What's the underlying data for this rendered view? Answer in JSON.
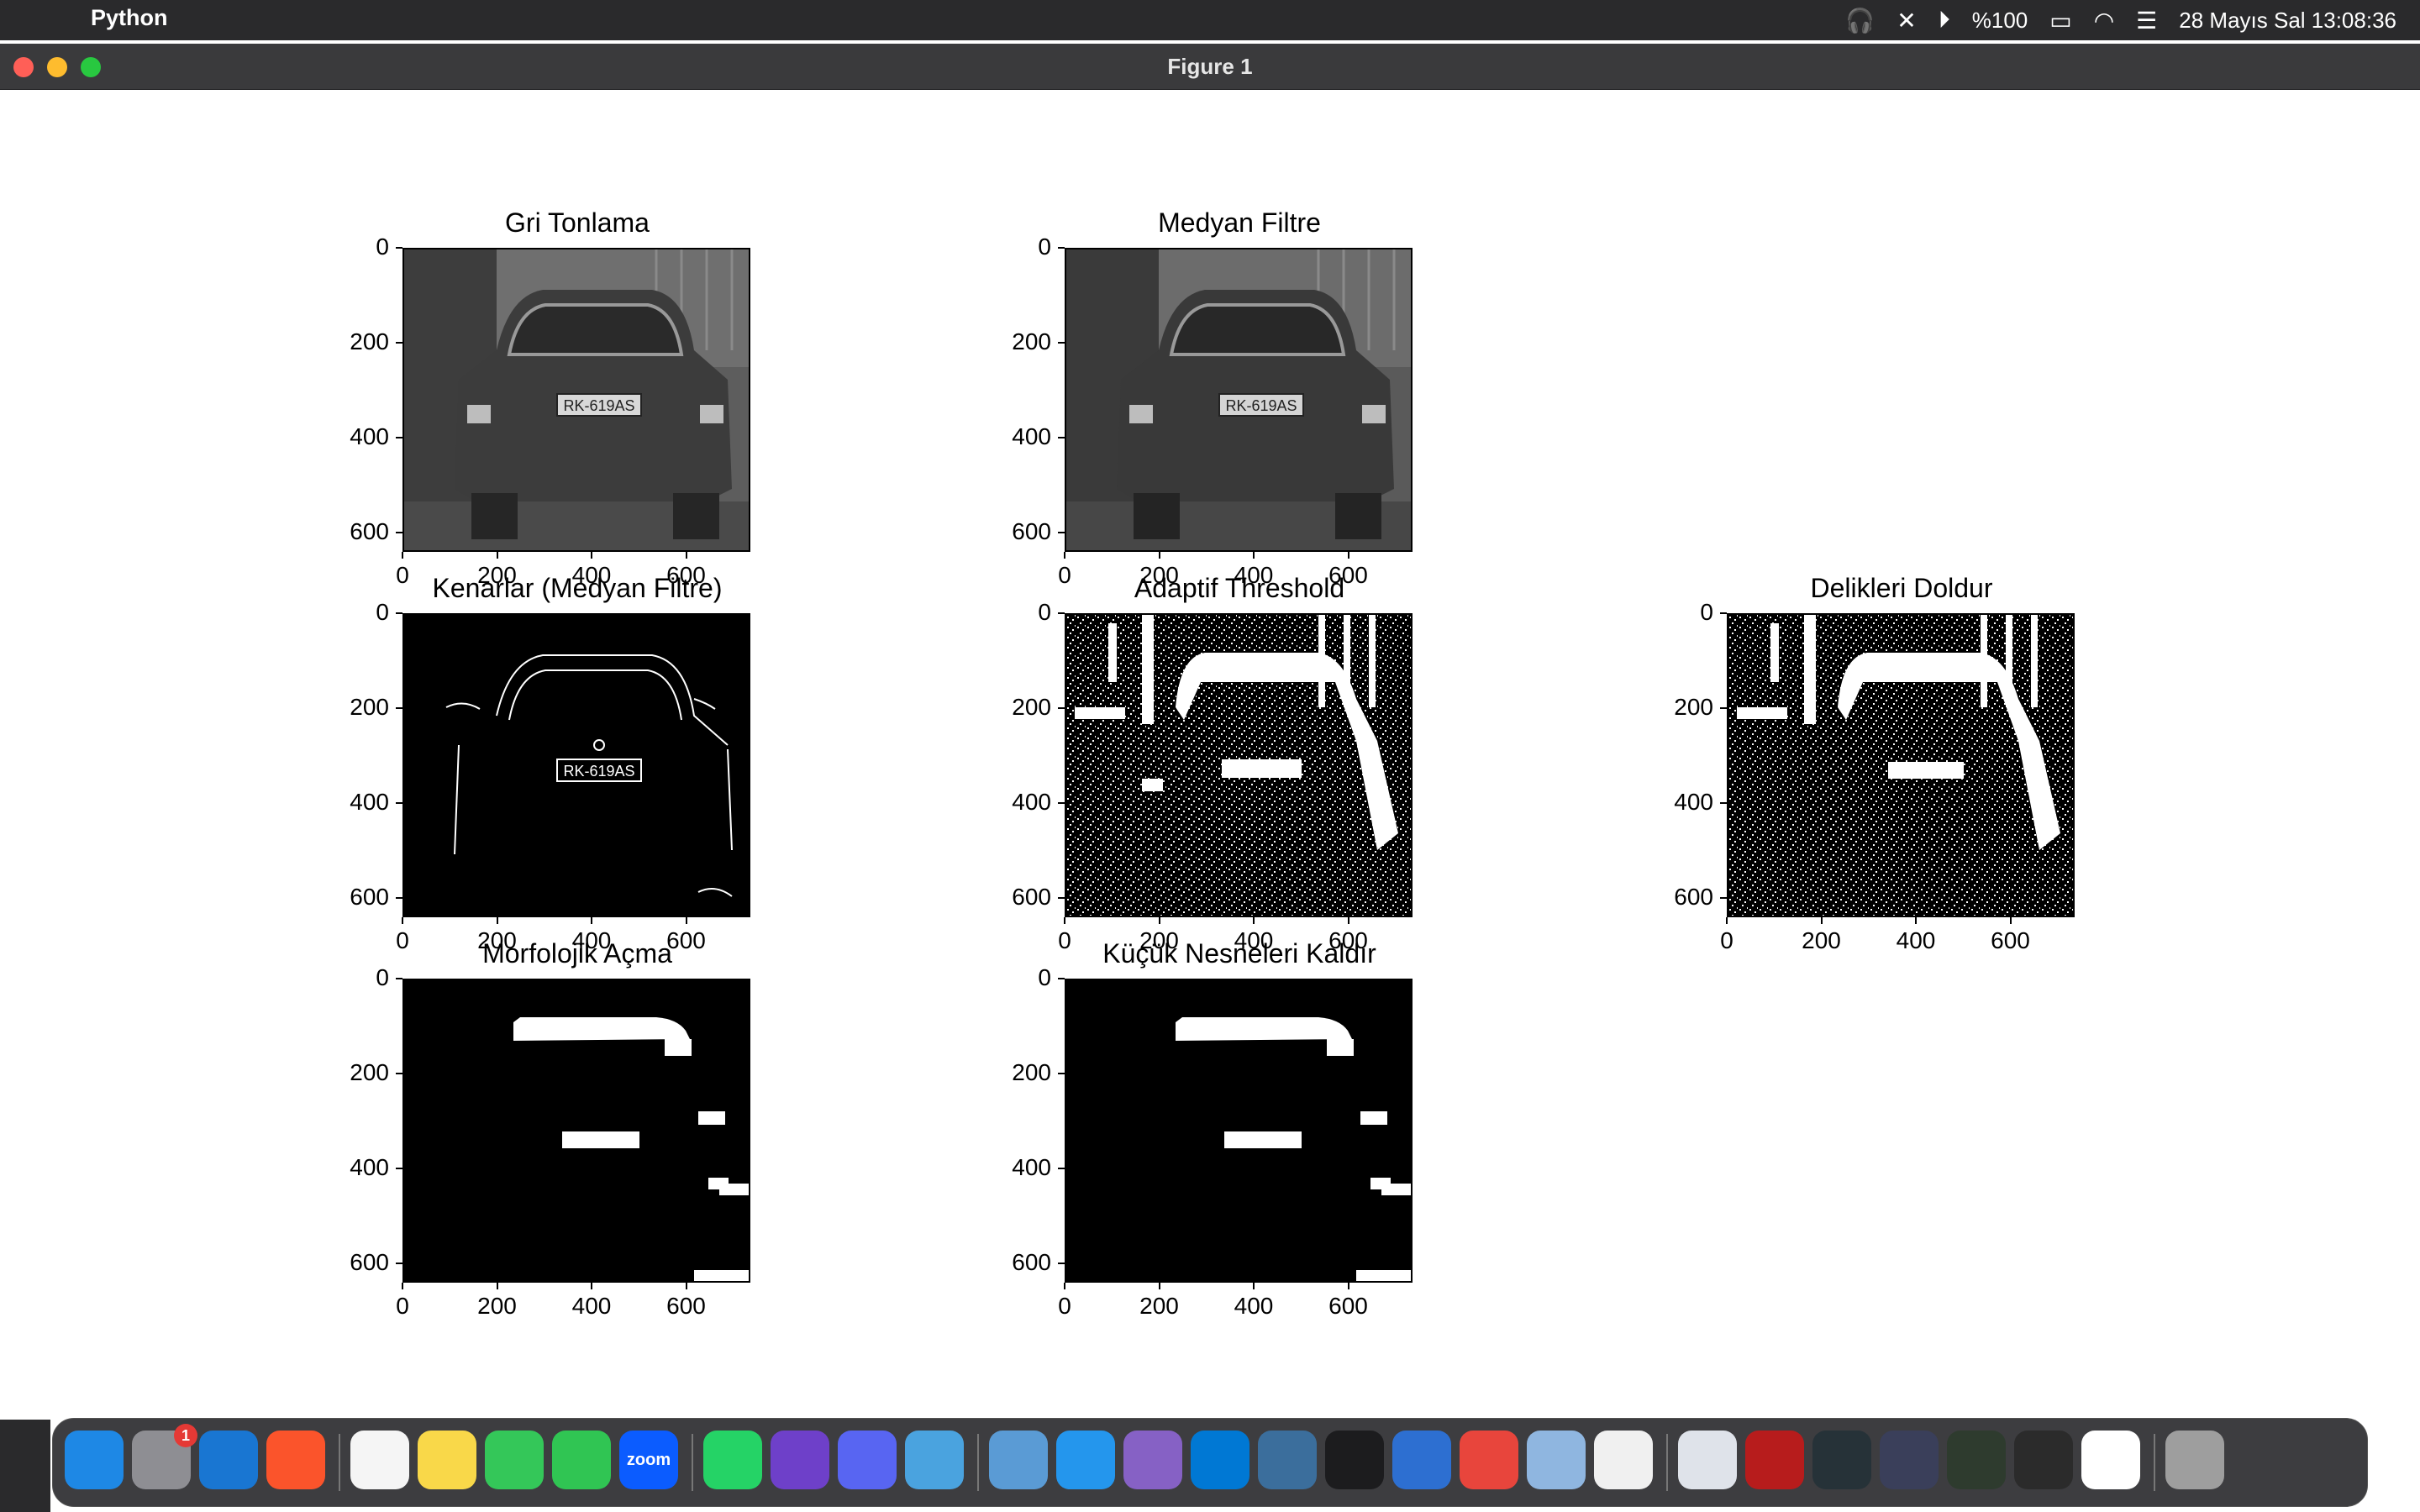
{
  "menubar": {
    "app_name": "Python",
    "battery": "%100",
    "datetime": "28 Mayıs Sal  13:08:36"
  },
  "window": {
    "title": "Figure 1"
  },
  "figure": {
    "subplots": [
      {
        "title": "Gri Tonlama",
        "yticks": [
          "0",
          "200",
          "400",
          "600"
        ],
        "xticks": [
          "0",
          "200",
          "400",
          "600"
        ]
      },
      {
        "title": "Medyan Filtre",
        "yticks": [
          "0",
          "200",
          "400",
          "600"
        ],
        "xticks": [
          "0",
          "200",
          "400",
          "600"
        ]
      },
      {
        "title": "Kenarlar (Medyan Filtre)",
        "yticks": [
          "0",
          "200",
          "400",
          "600"
        ],
        "xticks": [
          "0",
          "200",
          "400",
          "600"
        ]
      },
      {
        "title": "Adaptif Threshold",
        "yticks": [
          "0",
          "200",
          "400",
          "600"
        ],
        "xticks": [
          "0",
          "200",
          "400",
          "600"
        ]
      },
      {
        "title": "Delikleri Doldur",
        "yticks": [
          "0",
          "200",
          "400",
          "600"
        ],
        "xticks": [
          "0",
          "200",
          "400",
          "600"
        ]
      },
      {
        "title": "Morfolojik Açma",
        "yticks": [
          "0",
          "200",
          "400",
          "600"
        ],
        "xticks": [
          "0",
          "200",
          "400",
          "600"
        ]
      },
      {
        "title": "Küçük Nesneleri Kaldır",
        "yticks": [
          "0",
          "200",
          "400",
          "600"
        ],
        "xticks": [
          "0",
          "200",
          "400",
          "600"
        ]
      }
    ]
  },
  "plate_text": "RK-619AS",
  "dock": {
    "items": [
      {
        "icon": "finder-icon",
        "color": "#1e88e5"
      },
      {
        "icon": "system-settings-icon",
        "color": "#8e8e93",
        "badge": "1"
      },
      {
        "icon": "app-store-icon",
        "color": "#1976d2"
      },
      {
        "icon": "brave-icon",
        "color": "#fb542b"
      },
      {
        "icon": "notes-icon",
        "color": "#f5f5f5"
      },
      {
        "icon": "stickies-icon",
        "color": "#f9d849"
      },
      {
        "icon": "messages-icon",
        "color": "#34c759"
      },
      {
        "icon": "facetime-icon",
        "color": "#30c553"
      },
      {
        "icon": "zoom-icon",
        "color": "#0b5cff",
        "label": "zoom"
      },
      {
        "icon": "whatsapp-icon",
        "color": "#25d366"
      },
      {
        "icon": "github-icon",
        "color": "#6e40c9"
      },
      {
        "icon": "discord-icon",
        "color": "#5865f2"
      },
      {
        "icon": "xcode-icon",
        "color": "#4aa3df"
      },
      {
        "icon": "migration-icon",
        "color": "#5a9bd5"
      },
      {
        "icon": "docker-icon",
        "color": "#2496ed"
      },
      {
        "icon": "visual-studio-icon",
        "color": "#8661c5"
      },
      {
        "icon": "vscode-icon",
        "color": "#0078d4"
      },
      {
        "icon": "mysql-workbench-icon",
        "color": "#3b6e9c"
      },
      {
        "icon": "terminal-icon",
        "color": "#1c1c1e"
      },
      {
        "icon": "instruments-icon",
        "color": "#2d6fd1"
      },
      {
        "icon": "chrome-icon",
        "color": "#e8453c"
      },
      {
        "icon": "preview-icon",
        "color": "#8fb6e0"
      },
      {
        "icon": "pinwheel-icon",
        "color": "#f0f0f0"
      },
      {
        "icon": "window-thumb-1-icon",
        "color": "#dfe3ea"
      },
      {
        "icon": "window-thumb-2-icon",
        "color": "#b71c1c"
      },
      {
        "icon": "window-thumb-3-icon",
        "color": "#263238"
      },
      {
        "icon": "window-thumb-4-icon",
        "color": "#3a3f5a"
      },
      {
        "icon": "window-thumb-5-icon",
        "color": "#2e3b2e"
      },
      {
        "icon": "window-thumb-6-icon",
        "color": "#2b2b2b"
      },
      {
        "icon": "window-thumb-7-icon",
        "color": "#ffffff"
      },
      {
        "icon": "trash-icon",
        "color": "#9e9e9e"
      }
    ]
  }
}
